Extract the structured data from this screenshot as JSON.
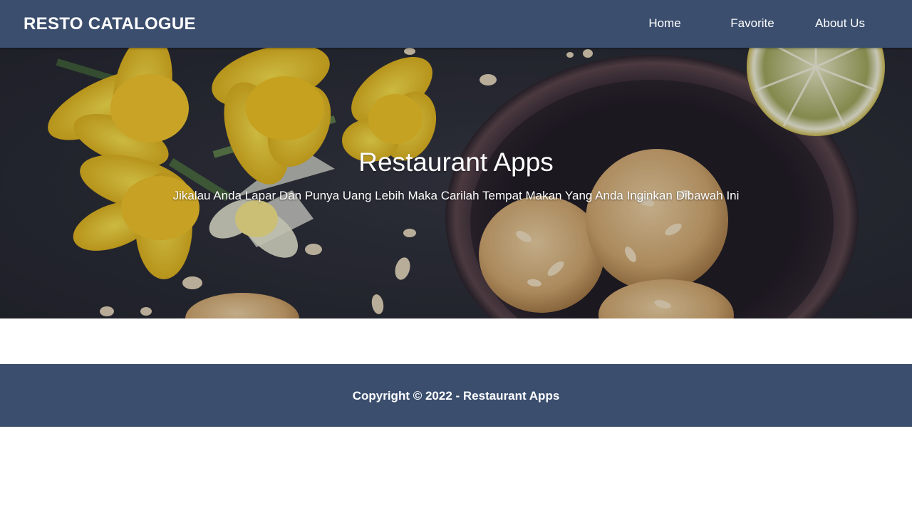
{
  "navbar": {
    "brand": "RESTO CATALOGUE",
    "links": [
      {
        "label": "Home"
      },
      {
        "label": "Favorite"
      },
      {
        "label": "About Us"
      }
    ],
    "background_color": "#3b4e6e"
  },
  "hero": {
    "title": "Restaurant Apps",
    "subtitle": "Jikalau Anda Lapar Dan Punya Uang Lebih Maka Carilah Tempat Makan Yang Anda Inginkan Dibawah Ini",
    "image_subject": "daffodils, almond cookies in a dark bowl, lemon slice"
  },
  "footer": {
    "copyright": "Copyright © 2022 - Restaurant Apps",
    "background_color": "#3b4e6e"
  }
}
